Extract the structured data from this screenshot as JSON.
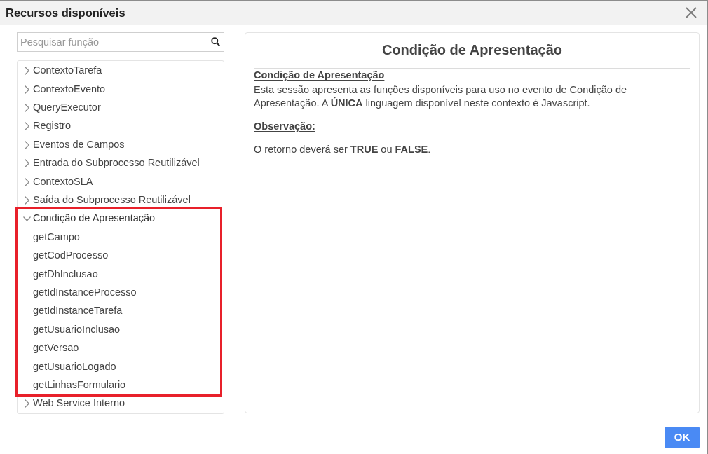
{
  "window": {
    "title": "Recursos disponíveis"
  },
  "search": {
    "placeholder": "Pesquisar função"
  },
  "tree": [
    {
      "label": "ContextoTarefa",
      "expanded": false,
      "selected": false,
      "highlighted": false
    },
    {
      "label": "ContextoEvento",
      "expanded": false,
      "selected": false,
      "highlighted": false
    },
    {
      "label": "QueryExecutor",
      "expanded": false,
      "selected": false,
      "highlighted": false
    },
    {
      "label": "Registro",
      "expanded": false,
      "selected": false,
      "highlighted": false
    },
    {
      "label": "Eventos de Campos",
      "expanded": false,
      "selected": false,
      "highlighted": false
    },
    {
      "label": "Entrada do Subprocesso Reutilizável",
      "expanded": false,
      "selected": false,
      "highlighted": false
    },
    {
      "label": "ContextoSLA",
      "expanded": false,
      "selected": false,
      "highlighted": false
    },
    {
      "label": "Saída do Subprocesso Reutilizável",
      "expanded": false,
      "selected": false,
      "highlighted": false
    },
    {
      "label": "Condição de Apresentação",
      "expanded": true,
      "selected": true,
      "highlighted": true,
      "children": [
        {
          "label": "getCampo"
        },
        {
          "label": "getCodProcesso"
        },
        {
          "label": "getDhInclusao"
        },
        {
          "label": "getIdInstanceProcesso"
        },
        {
          "label": "getIdInstanceTarefa"
        },
        {
          "label": "getUsuarioInclusao"
        },
        {
          "label": "getVersao"
        },
        {
          "label": "getUsuarioLogado"
        },
        {
          "label": "getLinhasFormulario"
        }
      ]
    },
    {
      "label": "Web Service Interno",
      "expanded": false,
      "selected": false,
      "highlighted": false
    }
  ],
  "detail": {
    "title": "Condição de Apresentação",
    "blocks": [
      {
        "heading": "Condição de Apresentação",
        "text": "Esta sessão apresenta as funções disponíveis para uso no evento de Condição de Apresentação. A **ÚNICA** linguagem disponível neste contexto é Javascript."
      },
      {
        "heading": "Observação:"
      },
      {
        "text": "O retorno deverá ser **TRUE** ou **FALSE**."
      }
    ]
  },
  "buttons": [
    {
      "label": "OK"
    }
  ]
}
